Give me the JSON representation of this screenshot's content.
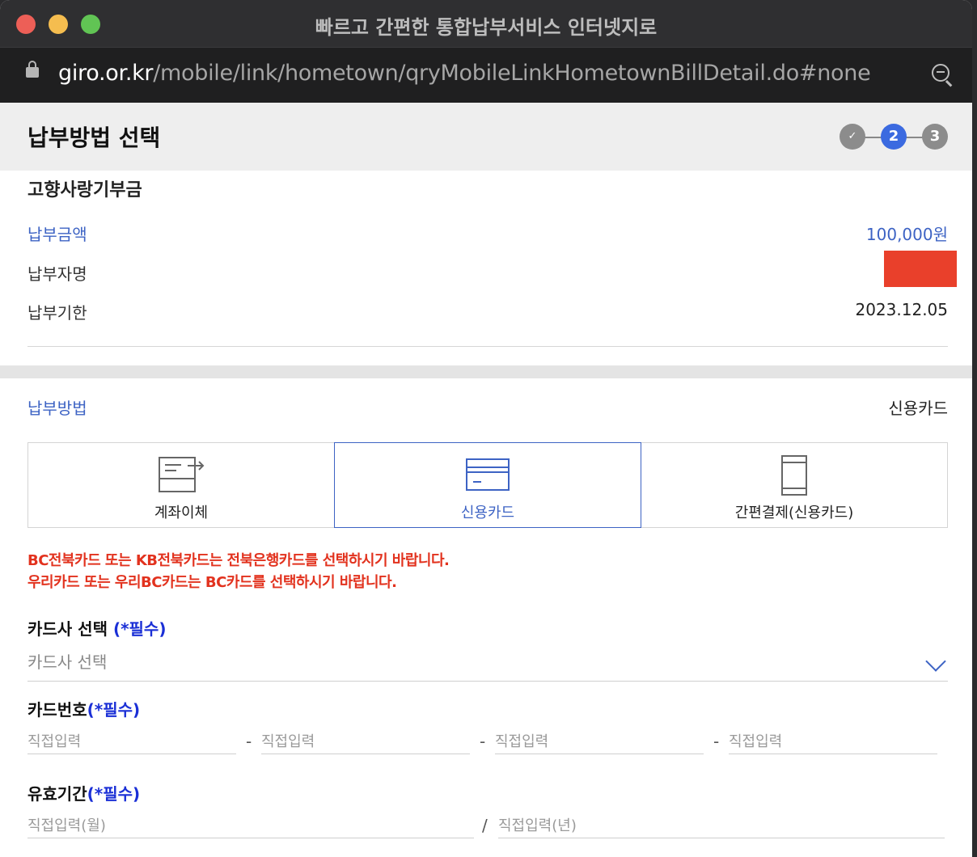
{
  "window": {
    "title": "빠르고 간편한 통합납부서비스 인터넷지로",
    "url_host": "giro.or.kr",
    "url_path": "/mobile/link/hometown/qryMobileLinkHometownBillDetail.do#none"
  },
  "header": {
    "title": "납부방법 선택",
    "steps": [
      {
        "label": "✓",
        "state": "done"
      },
      {
        "label": "2",
        "state": "active"
      },
      {
        "label": "3",
        "state": "todo"
      }
    ]
  },
  "bill": {
    "name": "고향사랑기부금",
    "rows": [
      {
        "label": "납부금액",
        "value": "100,000원"
      },
      {
        "label": "납부자명",
        "value": ""
      },
      {
        "label": "납부기한",
        "value": "2023.12.05"
      }
    ]
  },
  "payment": {
    "label": "납부방법",
    "selected": "신용카드",
    "methods": [
      {
        "label": "계좌이체",
        "icon": "bank-transfer-icon"
      },
      {
        "label": "신용카드",
        "icon": "credit-card-icon"
      },
      {
        "label": "간편결제(신용카드)",
        "icon": "mobile-phone-icon"
      }
    ],
    "notices": [
      "BC전북카드 또는 KB전북카드는 전북은행카드를 선택하시기 바랍니다.",
      "우리카드 또는 우리BC카드는 BC카드를 선택하시기 바랍니다."
    ]
  },
  "form": {
    "card_company": {
      "label": "카드사 선택",
      "required": "(*필수)",
      "placeholder": "카드사 선택"
    },
    "card_number": {
      "label": "카드번호",
      "required": "(*필수)",
      "placeholder": "직접입력",
      "separator": "-"
    },
    "expiry": {
      "label": "유효기간",
      "required": "(*필수)",
      "month_placeholder": "직접입력(월)",
      "year_placeholder": "직접입력(년)",
      "separator": "/"
    }
  },
  "colors": {
    "accent": "#3d63c4",
    "step_active": "#3b6ae0",
    "notice_red": "#e2321e",
    "required_blue": "#1a2fd6",
    "redaction": "#e9402b"
  }
}
